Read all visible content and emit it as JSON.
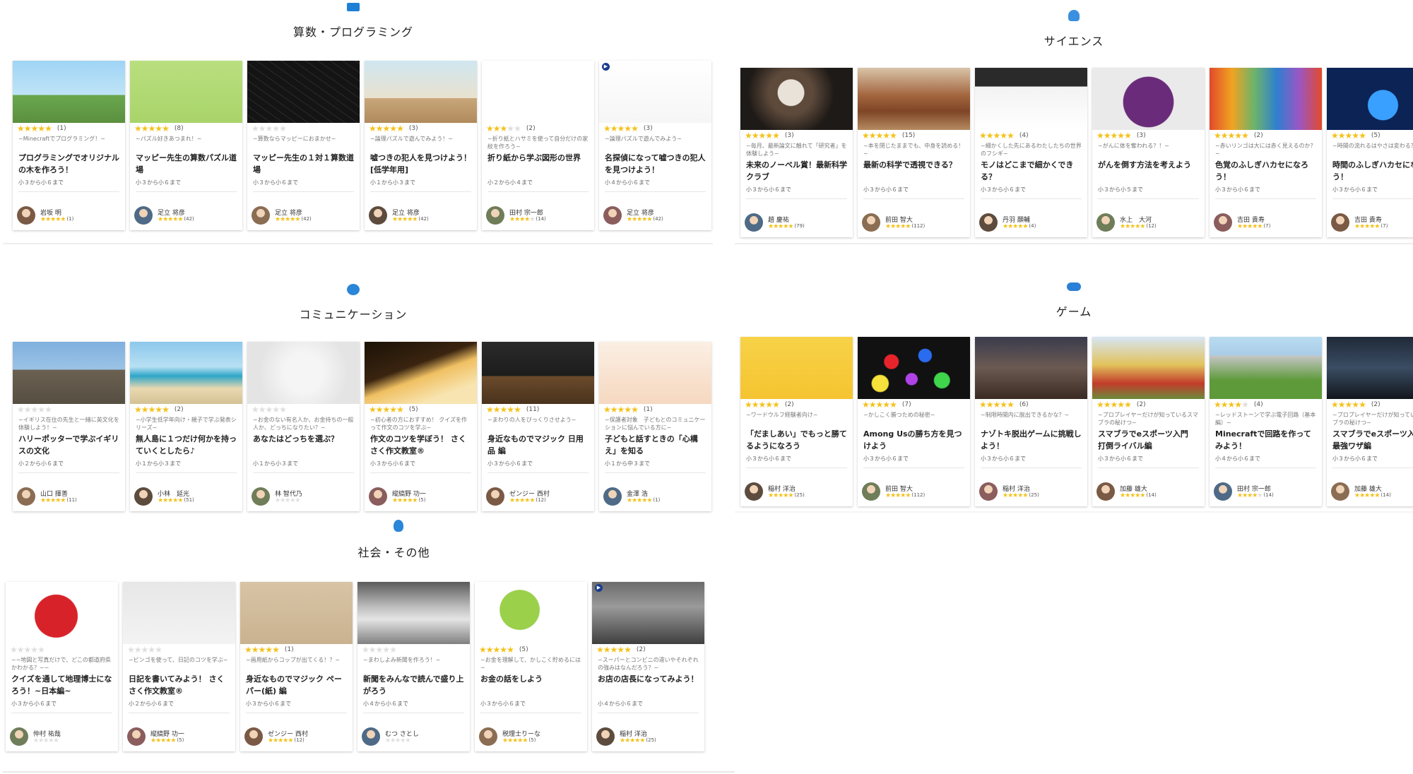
{
  "sections": [
    {
      "id": "math",
      "title": "算数・プログラミング",
      "icon": "laptop-icon",
      "cards": [
        {
          "stars": 5,
          "reviews": "(1)",
          "subtitle": "~Minecraftでプログラミング！~",
          "title": "プログラミングでオリジナルの木を作ろう！",
          "grade": "小３から小６まで",
          "teacher": "岩坂 明",
          "teacher_stars": 5,
          "teacher_reviews": "(1)",
          "thumb": "minecraft-tree",
          "play": false
        },
        {
          "stars": 5,
          "reviews": "(8)",
          "subtitle": "~パズル好きあつまれ！~",
          "title": "マッピー先生の算数パズル道場",
          "grade": "小３から小６まで",
          "teacher": "足立 将彦",
          "teacher_stars": 5,
          "teacher_reviews": "(42)",
          "thumb": "children-puzzle",
          "play": false
        },
        {
          "stars": 0,
          "reviews": "",
          "subtitle": "~算数ならマッピーにおまかせ~",
          "title": "マッピー先生の１対１算数道場",
          "grade": "小３から小６まで",
          "teacher": "足立 将彦",
          "teacher_stars": 5,
          "teacher_reviews": "(42)",
          "thumb": "chalkboard",
          "play": false
        },
        {
          "stars": 5,
          "reviews": "(3)",
          "subtitle": "~論理パズルで遊んでみよう！~",
          "title": "嘘つきの犯人を見つけよう！[低学年用]",
          "grade": "小１から小３まで",
          "teacher": "足立 将彦",
          "teacher_stars": 5,
          "teacher_reviews": "(42)",
          "thumb": "detective-room",
          "play": false
        },
        {
          "stars": 3,
          "reviews": "(2)",
          "subtitle": "~折り紙とハサミを使って自分だけの家紋を作ろう~",
          "title": "折り紙から学ぶ図形の世界",
          "grade": "小２から小４まで",
          "teacher": "田村 宗一郎",
          "teacher_stars": 4,
          "teacher_reviews": "(14)",
          "thumb": "family-crests",
          "play": false
        },
        {
          "stars": 5,
          "reviews": "(3)",
          "subtitle": "~論理パズルで遊んでみよう~",
          "title": "名探偵になって嘘つきの犯人を見つけよう！",
          "grade": "小４から小６まで",
          "teacher": "足立 将彦",
          "teacher_stars": 5,
          "teacher_reviews": "(42)",
          "thumb": "suspects",
          "play": true
        }
      ]
    },
    {
      "id": "science",
      "title": "サイエンス",
      "icon": "flask-icon",
      "cards": [
        {
          "stars": 5,
          "reviews": "(3)",
          "subtitle": "~毎月、最新論文に触れて「研究者」を体験しよう~",
          "title": "未来のノーベル賞！最新科学クラブ",
          "grade": "小３から小６まで",
          "teacher": "趙 慶祐",
          "teacher_stars": 5,
          "teacher_reviews": "(79)",
          "thumb": "einstein",
          "play": false
        },
        {
          "stars": 5,
          "reviews": "(15)",
          "subtitle": "~本を閉じたままでも、中身を読める！~",
          "title": "最新の科学で透視できる？",
          "grade": "小３から小６まで",
          "teacher": "前田 智大",
          "teacher_stars": 5,
          "teacher_reviews": "(112)",
          "thumb": "old-books",
          "play": false
        },
        {
          "stars": 5,
          "reviews": "(4)",
          "subtitle": "~細かくした先にあるわたしたちの世界のフシギ~",
          "title": "モノはどこまで細かくできる？",
          "grade": "小３から小６まで",
          "teacher": "丹羽 願輔",
          "teacher_stars": 5,
          "teacher_reviews": "(4)",
          "thumb": "science-icons",
          "play": false
        },
        {
          "stars": 5,
          "reviews": "(3)",
          "subtitle": "~がんに体を奪われる？！~",
          "title": "がんを倒す方法を考えよう",
          "grade": "小３から小５まで",
          "teacher": "水上　大河",
          "teacher_stars": 5,
          "teacher_reviews": "(12)",
          "thumb": "purple-monster",
          "play": false
        },
        {
          "stars": 5,
          "reviews": "(2)",
          "subtitle": "~赤いリンゴは大には赤く見えるのか？~",
          "title": "色覚のふしぎハカセになろう！",
          "grade": "小３から小６まで",
          "teacher": "吉田 貴寿",
          "teacher_stars": 5,
          "teacher_reviews": "(7)",
          "thumb": "color-tubes",
          "play": false
        },
        {
          "stars": 5,
          "reviews": "(5)",
          "subtitle": "~時間の流れるはやさは変わる？~",
          "title": "時間のふしぎハカセになろう！",
          "grade": "小３から小６まで",
          "teacher": "吉田 貴寿",
          "teacher_stars": 5,
          "teacher_reviews": "(7)",
          "thumb": "earth-clock",
          "play": false
        }
      ]
    },
    {
      "id": "communication",
      "title": "コミュニケーション",
      "icon": "chat-icon",
      "cards": [
        {
          "stars": 0,
          "reviews": "",
          "subtitle": "~イギリス在住の先生と一緒に英文化を体験しよう！~",
          "title": "ハリーポッターで学ぶイギリスの文化",
          "grade": "小２から小６まで",
          "teacher": "山口 揮善",
          "teacher_stars": 5,
          "teacher_reviews": "(11)",
          "thumb": "castle",
          "play": false
        },
        {
          "stars": 5,
          "reviews": "(2)",
          "subtitle": "~小学生低学年向け・親子で学ぶ発表シリーズ~",
          "title": "無人島に１つだけ何かを持っていくとしたら♪",
          "grade": "小１から小３まで",
          "teacher": "小林　延光",
          "teacher_stars": 5,
          "teacher_reviews": "(51)",
          "thumb": "beach",
          "play": false
        },
        {
          "stars": 0,
          "reviews": "",
          "subtitle": "~お金のない有名人か、お金持ちの一般人か、どっちになりたい？~",
          "title": "あなたはどっちを選ぶ？",
          "grade": "小１から小３まで",
          "teacher": "林 智代乃",
          "teacher_stars": 0,
          "teacher_reviews": "",
          "thumb": "scale",
          "play": false
        },
        {
          "stars": 5,
          "reviews": "(5)",
          "subtitle": "~初心者の方におすすめ！ クイズを作って作文のコツを学ぶ~",
          "title": "作文のコツを学ぼう！ さくさく作文教室®",
          "grade": "小３から小６まで",
          "teacher": "縦縞野 功一",
          "teacher_stars": 5,
          "teacher_reviews": "(5)",
          "thumb": "pen-paper",
          "play": false
        },
        {
          "stars": 5,
          "reviews": "(11)",
          "subtitle": "~まわりの人をびっくりさせよう~",
          "title": "身近なものでマジック 日用品 編",
          "grade": "小３から小６まで",
          "teacher": "ゼンジー 西村",
          "teacher_stars": 5,
          "teacher_reviews": "(12)",
          "thumb": "magic-table",
          "play": false
        },
        {
          "stars": 5,
          "reviews": "(1)",
          "subtitle": "~保護者対象　子どもとのコミュニケーションに悩んでいる方に~",
          "title": "子どもと話すときの「心構え」を知る",
          "grade": "小１から中３まで",
          "teacher": "金澤 浩",
          "teacher_stars": 5,
          "teacher_reviews": "(1)",
          "thumb": "mother-child",
          "play": false
        }
      ]
    },
    {
      "id": "game",
      "title": "ゲーム",
      "icon": "gamepad-icon",
      "cards": [
        {
          "stars": 5,
          "reviews": "(2)",
          "subtitle": "~ワードウルフ経験者向け~",
          "title": "「だましあい」でもっと勝てるようになろう",
          "grade": "小３から小６まで",
          "teacher": "稲村 洋治",
          "teacher_stars": 5,
          "teacher_reviews": "(25)",
          "thumb": "speech-bubbles",
          "play": false
        },
        {
          "stars": 5,
          "reviews": "(7)",
          "subtitle": "~かしこく勝つための秘密~",
          "title": "Among Usの勝ち方を見つけよう",
          "grade": "小３から小６まで",
          "teacher": "前田 智大",
          "teacher_stars": 5,
          "teacher_reviews": "(112)",
          "thumb": "among-us",
          "play": false
        },
        {
          "stars": 5,
          "reviews": "(6)",
          "subtitle": "~制限時間内に脱出できるかな？~",
          "title": "ナゾトキ脱出ゲームに挑戦しよう！",
          "grade": "小３から小６まで",
          "teacher": "稲村 洋治",
          "teacher_stars": 5,
          "teacher_reviews": "(25)",
          "thumb": "escape-room",
          "play": false
        },
        {
          "stars": 5,
          "reviews": "(2)",
          "subtitle": "~プロプレイヤーだけが知っているスマブラの秘けつ~",
          "title": "スマブラでeスポーツ入門　打倒ライバル編",
          "grade": "小３から小６まで",
          "teacher": "加藤 雄大",
          "teacher_stars": 5,
          "teacher_reviews": "(14)",
          "thumb": "figures",
          "play": false
        },
        {
          "stars": 4,
          "reviews": "(4)",
          "subtitle": "~レッドストーンで学ぶ電子回路（基本編）~",
          "title": "Minecraftで回路を作ってみよう！",
          "grade": "小４から小６まで",
          "teacher": "田村 宗一郎",
          "teacher_stars": 4,
          "teacher_reviews": "(14)",
          "thumb": "minecraft-circuit",
          "play": false
        },
        {
          "stars": 5,
          "reviews": "(2)",
          "subtitle": "~プロプレイヤーだけが知っているスマブラの秘けつ~",
          "title": "スマブラでeスポーツ入門　最強ワザ編",
          "grade": "小３から小６まで",
          "teacher": "加藤 雄大",
          "teacher_stars": 5,
          "teacher_reviews": "(14)",
          "thumb": "esports-stage",
          "play": false
        }
      ]
    },
    {
      "id": "society",
      "title": "社会・その他",
      "icon": "bulb-icon",
      "cards": [
        {
          "stars": 0,
          "reviews": "",
          "subtitle": "~~地図と写真だけで、どこの都道府県かわかる？~~",
          "title": "クイズを通して地理博士になろう！~日本編~",
          "grade": "小３から小６まで",
          "teacher": "仲村 祐哉",
          "teacher_stars": 0,
          "teacher_reviews": "",
          "thumb": "japan-map",
          "play": false
        },
        {
          "stars": 0,
          "reviews": "",
          "subtitle": "~ビンゴを使って、日記のコツを学ぶ~",
          "title": "日記を書いてみよう！ さくさく作文教室®",
          "grade": "小２から小６まで",
          "teacher": "縦縞野 功一",
          "teacher_stars": 5,
          "teacher_reviews": "(5)",
          "thumb": "notebook",
          "play": false
        },
        {
          "stars": 5,
          "reviews": "(1)",
          "subtitle": "~画用紙からコップが出てくる！？~",
          "title": "身近なものでマジック ペーパー(紙) 編",
          "grade": "小３から小６まで",
          "teacher": "ゼンジー 西村",
          "teacher_stars": 5,
          "teacher_reviews": "(12)",
          "thumb": "paper-pen",
          "play": false
        },
        {
          "stars": 0,
          "reviews": "",
          "subtitle": "~まわしよみ新聞を作ろう！~",
          "title": "新聞をみんなで読んで盛り上がろう",
          "grade": "小４から小６まで",
          "teacher": "むつ さとし",
          "teacher_stars": 0,
          "teacher_reviews": "",
          "thumb": "newspaper",
          "play": false
        },
        {
          "stars": 5,
          "reviews": "(5)",
          "subtitle": "~お金を理解して、かしこく貯めるには~",
          "title": "お金の話をしよう",
          "grade": "小３から小６まで",
          "teacher": "税理士りーな",
          "teacher_stars": 5,
          "teacher_reviews": "(5)",
          "thumb": "money-tree",
          "play": false
        },
        {
          "stars": 5,
          "reviews": "(2)",
          "subtitle": "~スーパーとコンビニの違いやそれぞれの強みはなんだろう？~",
          "title": "お店の店長になってみよう！",
          "grade": "小４から小６まで",
          "teacher": "稲村 洋治",
          "teacher_stars": 5,
          "teacher_reviews": "(25)",
          "thumb": "shopping-cart",
          "play": true
        }
      ]
    }
  ]
}
